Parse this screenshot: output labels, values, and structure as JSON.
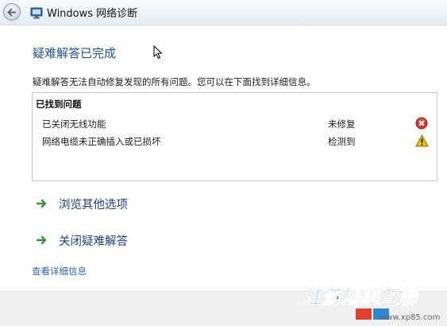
{
  "window": {
    "title": "Windows 网络诊断"
  },
  "page": {
    "title": "疑难解答已完成",
    "description": "疑难解答无法自动修复发现的所有问题。您可以在下面找到详细信息。"
  },
  "problems": {
    "header": "已找到问题",
    "items": [
      {
        "name": "已关闭无线功能",
        "status": "未修复",
        "icon": "error-icon"
      },
      {
        "name": "网络电缆未正确插入或已损坏",
        "status": "检测到",
        "icon": "warning-icon"
      }
    ]
  },
  "options": {
    "browse_label": "浏览其他选项",
    "close_label": "关闭疑难解答"
  },
  "details_link": "查看详细信息",
  "watermark": {
    "text": "江蘇鴻網互聯",
    "url": "www.xp85.com"
  },
  "colors": {
    "title": "#1e4f9b",
    "link": "#2b62b8",
    "error": "#d9342c",
    "warning": "#f2c200",
    "arrow": "#2e9c3a"
  }
}
